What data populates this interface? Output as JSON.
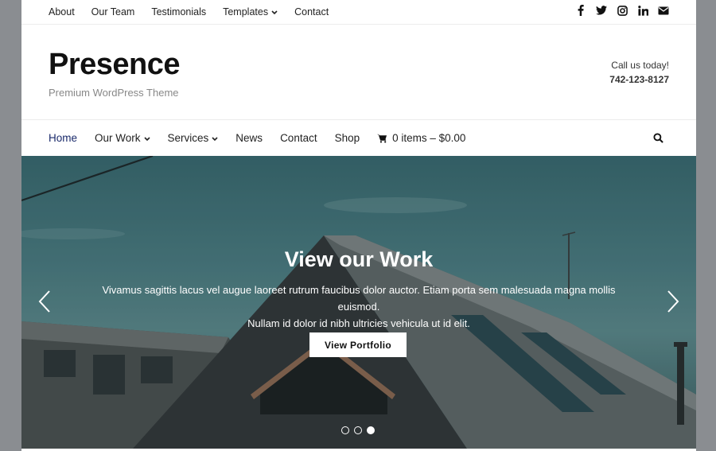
{
  "topbar": {
    "links": [
      "About",
      "Our Team",
      "Testimonials",
      "Templates",
      "Contact"
    ],
    "social_icons": [
      "facebook-icon",
      "twitter-icon",
      "instagram-icon",
      "linkedin-icon",
      "email-icon"
    ]
  },
  "header": {
    "title": "Presence",
    "tagline": "Premium WordPress Theme",
    "call_label": "Call us today!",
    "phone": "742-123-8127"
  },
  "mainnav": {
    "items": [
      "Home",
      "Our Work",
      "Services",
      "News",
      "Contact",
      "Shop"
    ],
    "cart": "0 items – $0.00"
  },
  "hero": {
    "title": "View our Work",
    "text_line1": "Vivamus sagittis lacus vel augue laoreet rutrum faucibus dolor auctor. Etiam porta sem malesuada magna mollis euismod.",
    "text_line2": "Nullam id dolor id nibh ultricies vehicula ut id elit.",
    "button": "View Portfolio",
    "slides": 3,
    "active_slide": 3
  },
  "colors": {
    "active_nav": "#1a2a6b",
    "hero_sky": "#4a7c82"
  }
}
